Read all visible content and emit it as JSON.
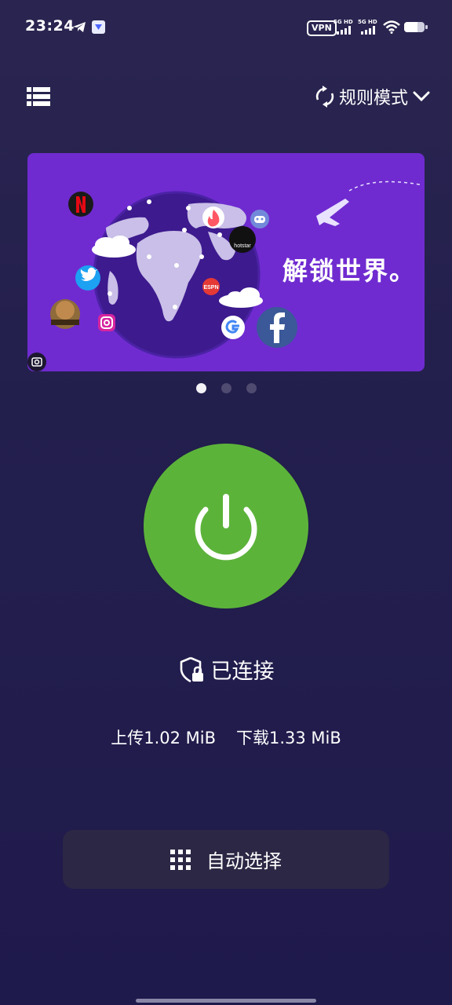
{
  "status_bar": {
    "time": "23:24",
    "vpn": "VPN",
    "sim1": "5G HD",
    "sim2": "5G HD"
  },
  "header": {
    "mode_label": "规则模式"
  },
  "banner": {
    "text": "解锁世界。",
    "page_count": 3,
    "active_page": 0,
    "logos": [
      "netflix",
      "tinder",
      "discord",
      "hotstar",
      "twitter",
      "espn",
      "pubg",
      "instagram",
      "google",
      "facebook"
    ]
  },
  "connection": {
    "status": "已连接",
    "upload": "上传1.02 MiB",
    "download": "下载1.33 MiB"
  },
  "server_select": {
    "label": "自动选择"
  },
  "colors": {
    "background": "#231f4d",
    "banner": "#6f2bd0",
    "power_button": "#5cb33a",
    "select_button": "#2c2744"
  }
}
